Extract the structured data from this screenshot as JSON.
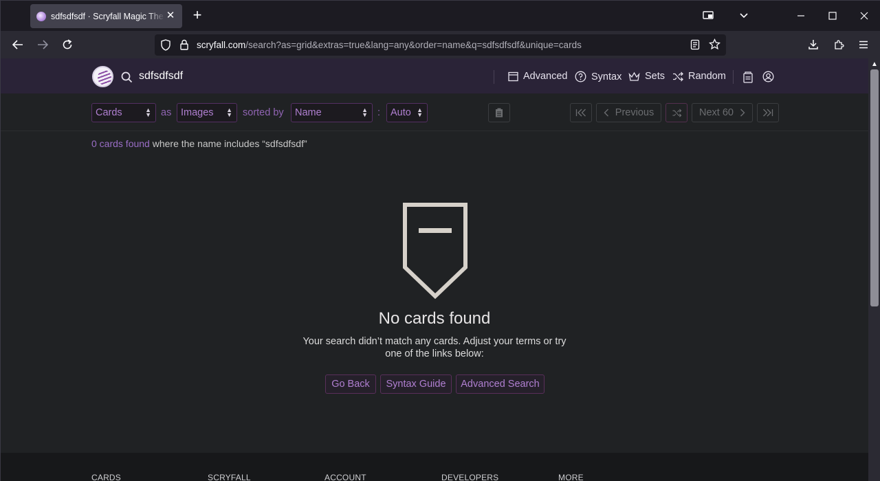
{
  "browser": {
    "tab_title": "sdfsdfsdf · Scryfall Magic The Gathering Search",
    "url_domain": "scryfall.com",
    "url_path": "/search?as=grid&extras=true&lang=any&order=name&q=sdfsdfsdf&unique=cards"
  },
  "header": {
    "search_query": "sdfsdfsdf",
    "nav": [
      "Advanced",
      "Syntax",
      "Sets",
      "Random"
    ]
  },
  "controls": {
    "display_select": "Cards",
    "as_label": "as",
    "mode_select": "Images",
    "sorted_label": "sorted by",
    "order_select": "Name",
    "colon": ":",
    "direction_select": "Auto",
    "previous_label": "Previous",
    "next_label": "Next 60"
  },
  "results": {
    "count_text": "0 cards found",
    "criteria_text": " where the name includes “sdfsdfsdf”"
  },
  "empty_state": {
    "title": "No cards found",
    "message": "Your search didn’t match any cards. Adjust your terms or try one of the links below:",
    "links": [
      "Go Back",
      "Syntax Guide",
      "Advanced Search"
    ]
  },
  "footer": {
    "columns": [
      "CARDS",
      "SCRYFALL",
      "ACCOUNT",
      "DEVELOPERS",
      "MORE"
    ]
  },
  "colors": {
    "header_bg": "#2a2337",
    "accent_purple": "#b07fd1",
    "page_bg": "#202224"
  }
}
